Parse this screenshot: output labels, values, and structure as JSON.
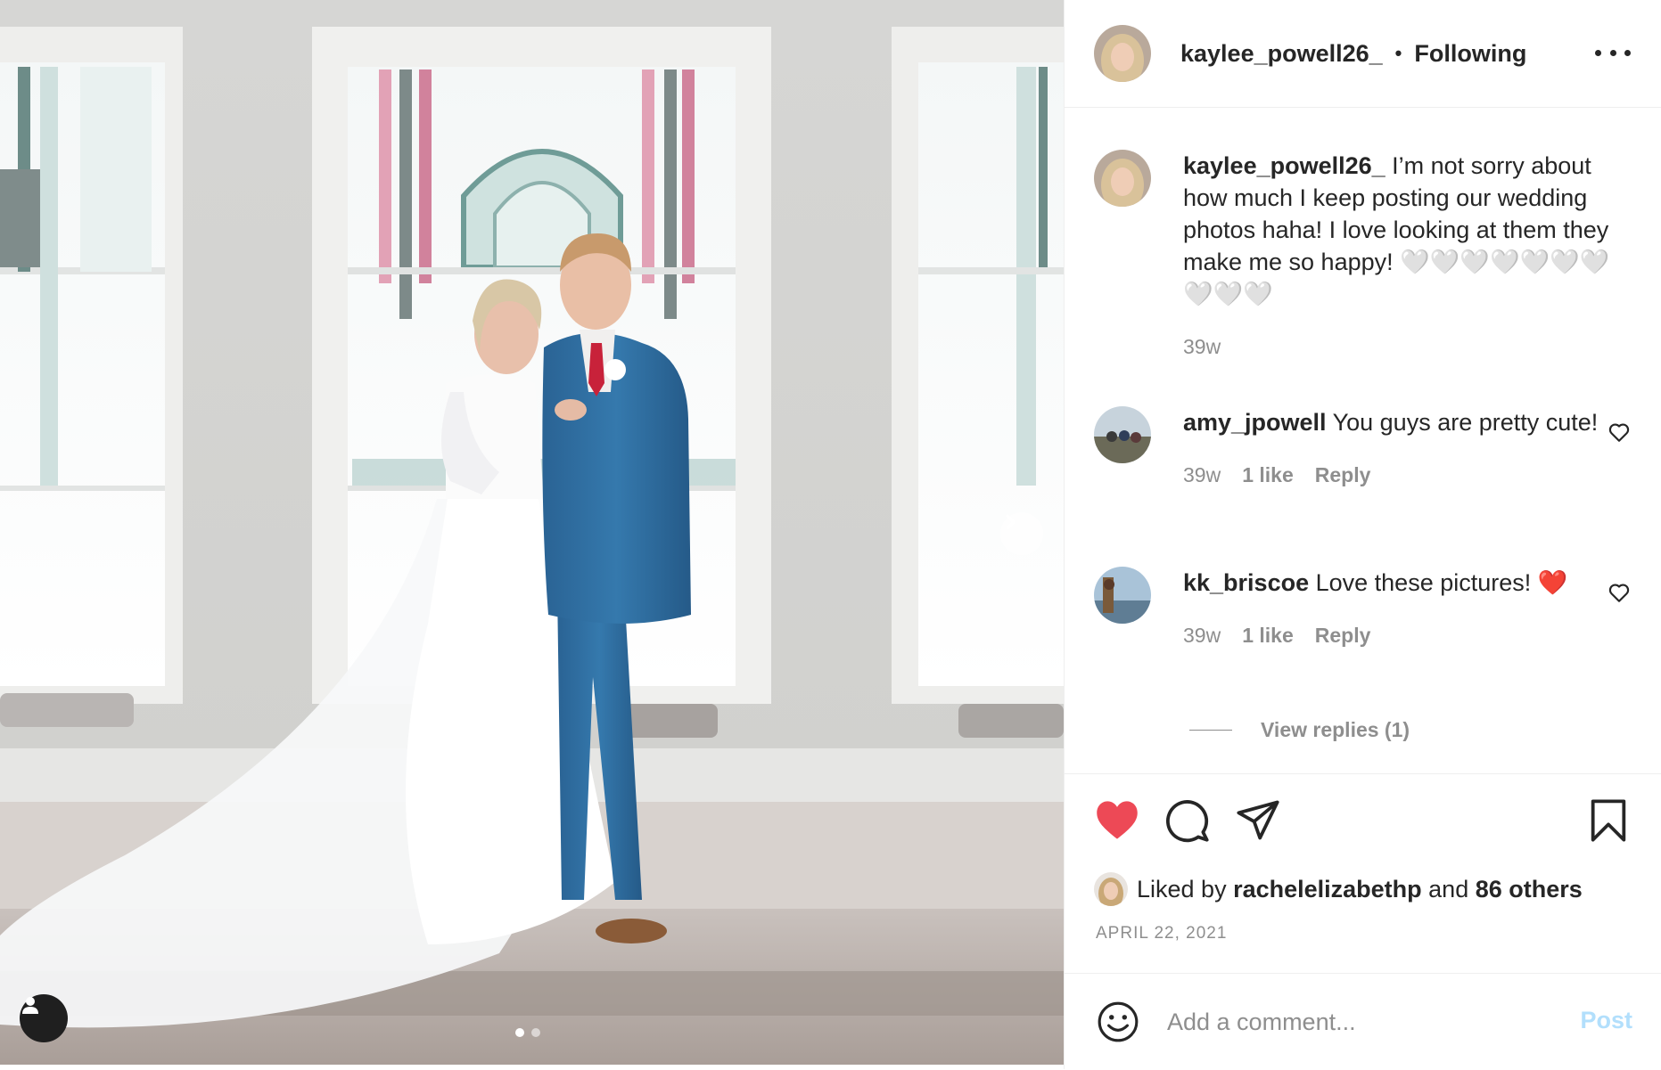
{
  "header": {
    "username": "kaylee_powell26_",
    "separator": "•",
    "follow_status": "Following"
  },
  "caption": {
    "username": "kaylee_powell26_",
    "text": "I’m not sorry about how much I keep posting our wedding photos haha! I love looking at them they make me so happy! 🤍🤍🤍🤍🤍🤍🤍🤍🤍🤍",
    "time": "39w"
  },
  "comments": [
    {
      "username": "amy_jpowell",
      "text": "You guys are pretty cute!",
      "time": "39w",
      "likes": "1 like",
      "reply_label": "Reply"
    },
    {
      "username": "kk_briscoe",
      "text": "Love these pictures! ❤️",
      "time": "39w",
      "likes": "1 like",
      "reply_label": "Reply"
    }
  ],
  "view_replies": "View replies (1)",
  "likes": {
    "prefix": "Liked by ",
    "user": "rachelelizabethp",
    "middle": " and ",
    "others": "86 others"
  },
  "date": "APRIL 22, 2021",
  "add_comment": {
    "placeholder": "Add a comment...",
    "post_label": "Post"
  },
  "carousel": {
    "current": 1,
    "total": 2
  },
  "colors": {
    "like_red": "#ed4956",
    "muted_text": "#8e8e8e",
    "post_disabled_blue": "#b2dffc",
    "groom_suit": "#2f6fa0"
  },
  "icons": [
    "more-icon",
    "heart-filled-icon",
    "comment-icon",
    "share-icon",
    "bookmark-icon",
    "heart-outline-icon",
    "emoji-icon",
    "chevron-right-icon",
    "user-tag-icon"
  ]
}
